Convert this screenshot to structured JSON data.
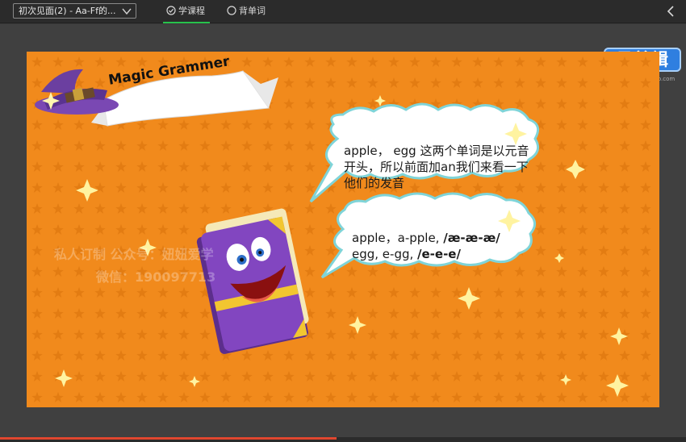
{
  "toolbar": {
    "lesson_select_value": "初次见面(2) - Aa-Ff的...",
    "tab_course": "学课程",
    "tab_vocab": "背单词"
  },
  "watermark": {
    "logo": "易剪辑",
    "url": "www.kdcbestudio.com",
    "line1": "私人订制  公众号：妞妞爱学",
    "line2": "微信：190097713"
  },
  "slide": {
    "title": "Magic Grammer",
    "bubble1": "apple， egg 这两个单词是以元音开头，所以前面加an我们来看一下他们的发音",
    "bubble2_line1_a": "apple，a-pple, ",
    "bubble2_line1_b": "/æ-æ-æ/",
    "bubble2_line2_a": "egg, e-gg, ",
    "bubble2_line2_b": "/e-e-e/",
    "colors": {
      "background": "#f18a1c",
      "star": "#e27a10",
      "book": "#7a3fb0",
      "ribbon": "#ffffff"
    }
  },
  "icons": {
    "select": "chevron-down-icon",
    "course": "check-circle-icon",
    "vocab": "radio-circle-icon",
    "back": "chevron-left-icon"
  },
  "progress": {
    "played_fraction": 0.49
  }
}
